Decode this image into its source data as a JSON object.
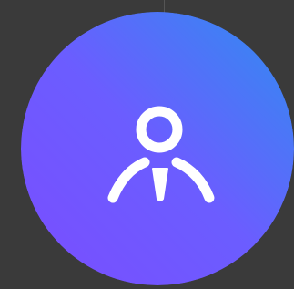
{
  "avatar": {
    "icon": "person-icon",
    "gradient_start": "#7a4dff",
    "gradient_end": "#2f8df0",
    "glyph_color": "#ffffff"
  },
  "background": "#3a3a3a"
}
